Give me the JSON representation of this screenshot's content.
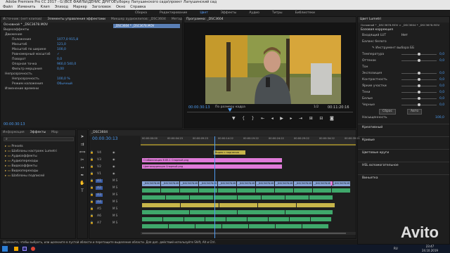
{
  "window": {
    "title": "Adobe Premiere Pro CC 2017 - G:\\ВСЕ ФАЙЛЫ\\ДЕНИС ДРУГОЕ\\сборку Лапушинского сада\\проект Лапушинский сад"
  },
  "menu": [
    "Файл",
    "Изменить",
    "Клип",
    "Эпизод",
    "Маркер",
    "Заголовок",
    "Окно",
    "Справка"
  ],
  "workspaces": [
    {
      "label": "Сборка",
      "active": false
    },
    {
      "label": "Редактирование",
      "active": false
    },
    {
      "label": "Цвет",
      "active": true
    },
    {
      "label": "Эффекты",
      "active": false
    },
    {
      "label": "Аудио",
      "active": false
    },
    {
      "label": "Титры",
      "active": false
    },
    {
      "label": "Библиотеки",
      "active": false
    }
  ],
  "effect_controls": {
    "tabs": [
      "Источник: (нет клипов)",
      "Элементы управления эффектами",
      "Микшер аудиоклипов: _DSC3604",
      "Метаданные"
    ],
    "clip_name": "Основной * _DSC3678.MOV",
    "sequence_clip": "_DSC3604 * _DSC3678.MOV",
    "section_video": "Видеоэффекты",
    "rows": [
      {
        "label": "Движение",
        "value": ""
      },
      {
        "label": "Положение",
        "value": "1077,0  915,8"
      },
      {
        "label": "Масштаб",
        "value": "121,0"
      },
      {
        "label": "Масштаб по ширине",
        "value": "100,0"
      },
      {
        "label": "Равномерный масштаб",
        "value": "✓"
      },
      {
        "label": "Поворот",
        "value": "0,0"
      },
      {
        "label": "Опорная точка",
        "value": "960,0  540,0"
      },
      {
        "label": "Фильтр мерцания",
        "value": "0,00"
      },
      {
        "label": "Непрозрачность",
        "value": ""
      },
      {
        "label": "Непрозрачность",
        "value": "100,0 %"
      },
      {
        "label": "Режим наложения",
        "value": "Обычный"
      },
      {
        "label": "Изменение времени",
        "value": ""
      }
    ],
    "timecode": "00:00:30:13"
  },
  "program": {
    "title": "Программа: _DSC3604",
    "timecode_current": "00:00:30:13",
    "fit": "По размеру кадра",
    "fraction": "1/2",
    "timecode_total": "00:11:20:16",
    "controls": [
      "marker-icon",
      "in-point-icon",
      "out-point-icon",
      "go-to-in-icon",
      "step-back-icon",
      "play-icon",
      "step-forward-icon",
      "go-to-out-icon",
      "insert-icon",
      "overwrite-icon",
      "export-frame-icon"
    ]
  },
  "lumetri": {
    "title": "Цвет Lumetri",
    "clip": "Основной * _DSC3678.MOV  >  _DSC3604 * _DSC3678.MOV",
    "section_basic": "Базовая коррекция",
    "input_lut_label": "Входящий LUT",
    "input_lut_value": "Нет",
    "wb_label": "Баланс белого",
    "wb_picker": "Инструмент выбора ББ",
    "tone": "Тон",
    "sliders": [
      {
        "label": "Температура",
        "value": "0,0",
        "pos": 0.5
      },
      {
        "label": "Оттенок",
        "value": "0,0",
        "pos": 0.5
      },
      {
        "label": "Экспозиция",
        "value": "0,0",
        "pos": 0.5
      },
      {
        "label": "Контрастность",
        "value": "0,0",
        "pos": 0.5
      },
      {
        "label": "Яркие участки",
        "value": "0,0",
        "pos": 0.5
      },
      {
        "label": "Тени",
        "value": "0,0",
        "pos": 0.5
      },
      {
        "label": "Белые",
        "value": "0,0",
        "pos": 0.5
      },
      {
        "label": "Черные",
        "value": "0,0",
        "pos": 0.5
      }
    ],
    "reset": "Сброс",
    "auto": "Авто",
    "saturation_label": "Насыщенность",
    "saturation_value": "100,0",
    "sections": [
      "Креативный",
      "Кривые",
      "Цветовые круги",
      "HSL вспомогательное",
      "Виньетка"
    ]
  },
  "project": {
    "tabs": [
      "Информация",
      "Эффекты",
      "Мар"
    ],
    "items": [
      "Presets",
      "Шаблоны настроек Lumetri",
      "Аудиоэффекты",
      "Аудиопереходы",
      "Видеоэффекты",
      "Видеопереходы",
      "Шаблоны подписей"
    ]
  },
  "timeline": {
    "title": "_DSC3604",
    "timecode": "00:00:30:13",
    "ruler": [
      "00:00:00:00",
      "00:00:04:23",
      "00:00:09:23",
      "00:00:14:22",
      "00:00:19:22",
      "00:00:24:22",
      "00:00:29:22",
      "00:00:34:22",
      "00:00:39:21"
    ],
    "tracks_video": [
      "V4",
      "V3",
      "V2",
      "V1"
    ],
    "tracks_audio": [
      "A1",
      "A2",
      "A3",
      "A4",
      "A5",
      "A6",
      "A7"
    ],
    "title_clips": [
      "Видео с подписью",
      "Стабилизация В 85-1 Спорный.png",
      "Цветокоррекция Спорный.png"
    ],
    "v1_clip": "_DSC3678.MOV"
  },
  "status": {
    "text": "Щелкните, чтобы выбрать, или щелкните в пустой области и перетащите выделение области. Для доп. действий используйте Shift, Alt и Ctrl."
  },
  "taskbar": {
    "time": "23:47",
    "date": "24.10.2019",
    "lang": "RU"
  },
  "watermark": "Avito",
  "colors": {
    "accent": "#4d9bf0",
    "video_clip": "#88a4d6",
    "title_clip": "#e07bd9",
    "audio_clip": "#3fa86b",
    "playhead": "#4d9bf0"
  }
}
